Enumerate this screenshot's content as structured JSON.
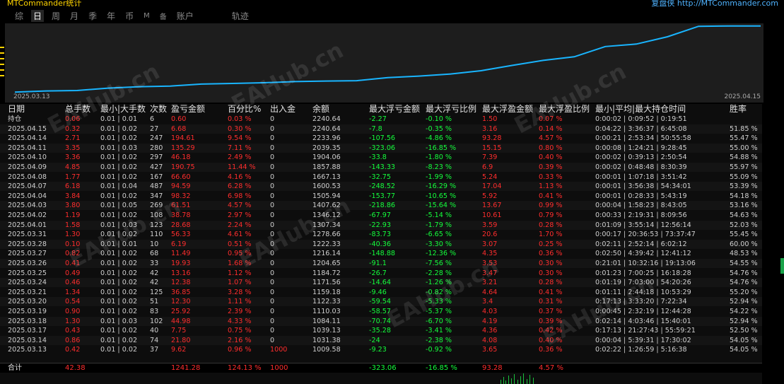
{
  "header": {
    "title": "MTCommander统计",
    "right_text": "复盘侠 http://MTCommander.com"
  },
  "tabs": [
    {
      "label": "综",
      "active": false
    },
    {
      "label": "日",
      "active": true
    },
    {
      "label": "周",
      "active": false
    },
    {
      "label": "月",
      "active": false
    },
    {
      "label": "季",
      "active": false
    },
    {
      "label": "年",
      "active": false
    },
    {
      "label": "币",
      "active": false
    },
    {
      "label": "M",
      "active": false
    },
    {
      "label": "备",
      "active": false
    },
    {
      "label": "账户",
      "active": false
    },
    {
      "label": "轨迹",
      "active": false
    }
  ],
  "chart_data": {
    "type": "line",
    "x_start_label": "2025.03.13",
    "x_end_label": "2025.04.15",
    "x": [
      "2025.03.13",
      "2025.03.14",
      "2025.03.17",
      "2025.03.18",
      "2025.03.19",
      "2025.03.20",
      "2025.03.21",
      "2025.03.24",
      "2025.03.25",
      "2025.03.26",
      "2025.03.27",
      "2025.03.28",
      "2025.03.31",
      "2025.04.01",
      "2025.04.02",
      "2025.04.03",
      "2025.04.04",
      "2025.04.07",
      "2025.04.08",
      "2025.04.09",
      "2025.04.10",
      "2025.04.11",
      "2025.04.14",
      "2025.04.15",
      "持仓"
    ],
    "series": [
      {
        "values": [
          1009.58,
          1031.38,
          1039.13,
          1084.11,
          1110.03,
          1122.33,
          1159.18,
          1171.56,
          1184.72,
          1204.65,
          1216.14,
          1222.33,
          1278.66,
          1307.34,
          1346.12,
          1407.62,
          1505.94,
          1600.53,
          1667.13,
          1857.88,
          1904.06,
          2039.35,
          2233.96,
          2240.64,
          2240.64
        ]
      }
    ],
    "line_color": "#19b5ff",
    "grid": false
  },
  "table": {
    "headers": [
      "日期",
      "总手数",
      "最小|大手数",
      "次数",
      "盈亏金额",
      "百分比%",
      "出入金",
      "余额",
      "最大浮亏金额",
      "最大浮亏比例",
      "最大浮盈金额",
      "最大浮盈比例",
      "最小|平均|最大持仓时间",
      "胜率"
    ],
    "position_row_label": "持仓",
    "rows": [
      [
        "持仓",
        "0.06",
        "0.01 | 0.01",
        "6",
        "0.60",
        "0.03 %",
        "0",
        "2240.64",
        "-2.27",
        "-0.10 %",
        "1.50",
        "0.07 %",
        "0:00:02 | 0:09:52 | 0:19:51",
        ""
      ],
      [
        "2025.04.15",
        "0.32",
        "0.01 | 0.02",
        "27",
        "6.68",
        "0.30 %",
        "0",
        "2240.64",
        "-7.8",
        "-0.35 %",
        "3.16",
        "0.14 %",
        "0:04:22 | 3:36:37 | 6:45:08",
        "51.85 %"
      ],
      [
        "2025.04.14",
        "2.71",
        "0.01 | 0.02",
        "247",
        "194.61",
        "9.54 %",
        "0",
        "2233.96",
        "-107.56",
        "-4.86 %",
        "93.28",
        "4.57 %",
        "0:00:21 | 2:53:34 | 50:55:58",
        "55.47 %"
      ],
      [
        "2025.04.11",
        "3.35",
        "0.01 | 0.03",
        "280",
        "135.29",
        "7.11 %",
        "0",
        "2039.35",
        "-323.06",
        "-16.85 %",
        "15.15",
        "0.80 %",
        "0:00:08 | 1:24:21 | 9:28:45",
        "55.00 %"
      ],
      [
        "2025.04.10",
        "3.36",
        "0.01 | 0.02",
        "297",
        "46.18",
        "2.49 %",
        "0",
        "1904.06",
        "-33.8",
        "-1.80 %",
        "7.39",
        "0.40 %",
        "0:00:02 | 0:39:13 | 2:50:54",
        "54.88 %"
      ],
      [
        "2025.04.09",
        "4.85",
        "0.01 | 0.02",
        "427",
        "190.75",
        "11.44 %",
        "0",
        "1857.88",
        "-143.33",
        "-8.23 %",
        "6.9",
        "0.39 %",
        "0:00:02 | 0:48:48 | 8:30:39",
        "55.97 %"
      ],
      [
        "2025.04.08",
        "1.77",
        "0.01 | 0.02",
        "167",
        "66.60",
        "4.16 %",
        "0",
        "1667.13",
        "-32.75",
        "-1.99 %",
        "5.24",
        "0.33 %",
        "0:00:01 | 1:07:18 | 3:51:42",
        "55.09 %"
      ],
      [
        "2025.04.07",
        "6.18",
        "0.01 | 0.04",
        "487",
        "94.59",
        "6.28 %",
        "0",
        "1600.53",
        "-248.52",
        "-16.29 %",
        "17.04",
        "1.13 %",
        "0:00:01 | 3:56:38 | 54:34:01",
        "53.39 %"
      ],
      [
        "2025.04.04",
        "3.84",
        "0.01 | 0.02",
        "347",
        "98.32",
        "6.98 %",
        "0",
        "1505.94",
        "-153.77",
        "-10.65 %",
        "5.92",
        "0.41 %",
        "0:00:01 | 0:28:33 | 5:43:19",
        "54.18 %"
      ],
      [
        "2025.04.03",
        "3.80",
        "0.01 | 0.05",
        "269",
        "61.51",
        "4.57 %",
        "0",
        "1407.62",
        "-218.86",
        "-15.64 %",
        "13.67",
        "0.99 %",
        "0:00:04 | 1:58:23 | 8:43:05",
        "53.16 %"
      ],
      [
        "2025.04.02",
        "1.19",
        "0.01 | 0.02",
        "108",
        "38.78",
        "2.97 %",
        "0",
        "1346.12",
        "-67.97",
        "-5.14 %",
        "10.61",
        "0.79 %",
        "0:00:33 | 2:19:31 | 8:09:56",
        "54.63 %"
      ],
      [
        "2025.04.01",
        "1.58",
        "0.01 | 0.03",
        "123",
        "28.68",
        "2.24 %",
        "0",
        "1307.34",
        "-22.93",
        "-1.79 %",
        "3.59",
        "0.28 %",
        "0:01:09 | 3:55:14 | 12:56:14",
        "52.03 %"
      ],
      [
        "2025.03.31",
        "1.30",
        "0.01 | 0.02",
        "110",
        "56.33",
        "4.61 %",
        "0",
        "1278.66",
        "-83.73",
        "-6.65 %",
        "20.6",
        "1.70 %",
        "0:00:17 | 20:36:53 | 73:37:47",
        "55.45 %"
      ],
      [
        "2025.03.28",
        "0.10",
        "0.01 | 0.01",
        "10",
        "6.19",
        "0.51 %",
        "0",
        "1222.33",
        "-40.36",
        "-3.30 %",
        "3.07",
        "0.25 %",
        "0:02:11 | 2:52:14 | 6:02:12",
        "60.00 %"
      ],
      [
        "2025.03.27",
        "0.82",
        "0.01 | 0.02",
        "68",
        "11.49",
        "0.95 %",
        "0",
        "1216.14",
        "-148.88",
        "-12.36 %",
        "4.35",
        "0.36 %",
        "0:02:50 | 4:39:42 | 12:41:12",
        "48.53 %"
      ],
      [
        "2025.03.26",
        "0.41",
        "0.01 | 0.02",
        "33",
        "19.93",
        "1.68 %",
        "0",
        "1204.65",
        "-91.1",
        "-7.56 %",
        "3.53",
        "0.30 %",
        "0:21:01 | 10:32:16 | 19:13:06",
        "54.55 %"
      ],
      [
        "2025.03.25",
        "0.49",
        "0.01 | 0.02",
        "42",
        "13.16",
        "1.12 %",
        "0",
        "1184.72",
        "-26.7",
        "-2.28 %",
        "3.47",
        "0.30 %",
        "0:01:23 | 7:00:25 | 16:18:28",
        "54.76 %"
      ],
      [
        "2025.03.24",
        "0.46",
        "0.01 | 0.02",
        "42",
        "12.38",
        "1.07 %",
        "0",
        "1171.56",
        "-14.64",
        "-1.26 %",
        "3.21",
        "0.28 %",
        "0:01:19 | 7:03:00 | 54:20:26",
        "54.76 %"
      ],
      [
        "2025.03.21",
        "1.34",
        "0.01 | 0.02",
        "125",
        "36.85",
        "3.28 %",
        "0",
        "1159.18",
        "-9.46",
        "-0.82 %",
        "4.64",
        "0.41 %",
        "0:01:11 | 2:44:18 | 10:53:29",
        "55.20 %"
      ],
      [
        "2025.03.20",
        "0.54",
        "0.01 | 0.02",
        "51",
        "12.30",
        "1.11 %",
        "0",
        "1122.33",
        "-59.54",
        "-5.33 %",
        "3.4",
        "0.31 %",
        "0:17:13 | 3:33:20 | 7:22:34",
        "52.94 %"
      ],
      [
        "2025.03.19",
        "0.90",
        "0.01 | 0.02",
        "83",
        "25.92",
        "2.39 %",
        "0",
        "1110.03",
        "-58.57",
        "-5.37 %",
        "4.03",
        "0.37 %",
        "0:00:45 | 2:32:19 | 12:44:28",
        "54.22 %"
      ],
      [
        "2025.03.18",
        "1.30",
        "0.01 | 0.03",
        "102",
        "44.98",
        "4.33 %",
        "0",
        "1084.11",
        "-70.74",
        "-6.70 %",
        "4.19",
        "0.39 %",
        "0:02:14 | 4:03:46 | 15:40:01",
        "52.94 %"
      ],
      [
        "2025.03.17",
        "0.43",
        "0.01 | 0.02",
        "40",
        "7.75",
        "0.75 %",
        "0",
        "1039.13",
        "-35.28",
        "-3.41 %",
        "4.36",
        "0.42 %",
        "0:17:13 | 21:27:43 | 55:59:21",
        "52.50 %"
      ],
      [
        "2025.03.14",
        "0.86",
        "0.01 | 0.02",
        "74",
        "21.80",
        "2.16 %",
        "0",
        "1031.38",
        "-24",
        "-2.38 %",
        "4.08",
        "0.40 %",
        "0:00:04 | 5:39:31 | 17:30:02",
        "54.05 %"
      ],
      [
        "2025.03.13",
        "0.42",
        "0.01 | 0.02",
        "37",
        "9.62",
        "0.96 %",
        "1000",
        "1009.58",
        "-9.23",
        "-0.92 %",
        "3.65",
        "0.36 %",
        "0:02:22 | 1:26:59 | 5:16:38",
        "54.05 %"
      ]
    ],
    "total": {
      "label": "合计",
      "lots": "42.38",
      "pnl": "1241.28",
      "pct": "124.13 %",
      "deposit": "1000",
      "max_float_loss": "-323.06",
      "max_float_loss_pct": "-16.85 %",
      "max_float_profit": "93.28",
      "max_float_profit_pct": "4.57 %"
    },
    "colors": {
      "positive": "#ff2d2d",
      "negative": "#14ff3c",
      "neutral": "#d0d0d0"
    }
  },
  "watermark": "EAHub.cn"
}
